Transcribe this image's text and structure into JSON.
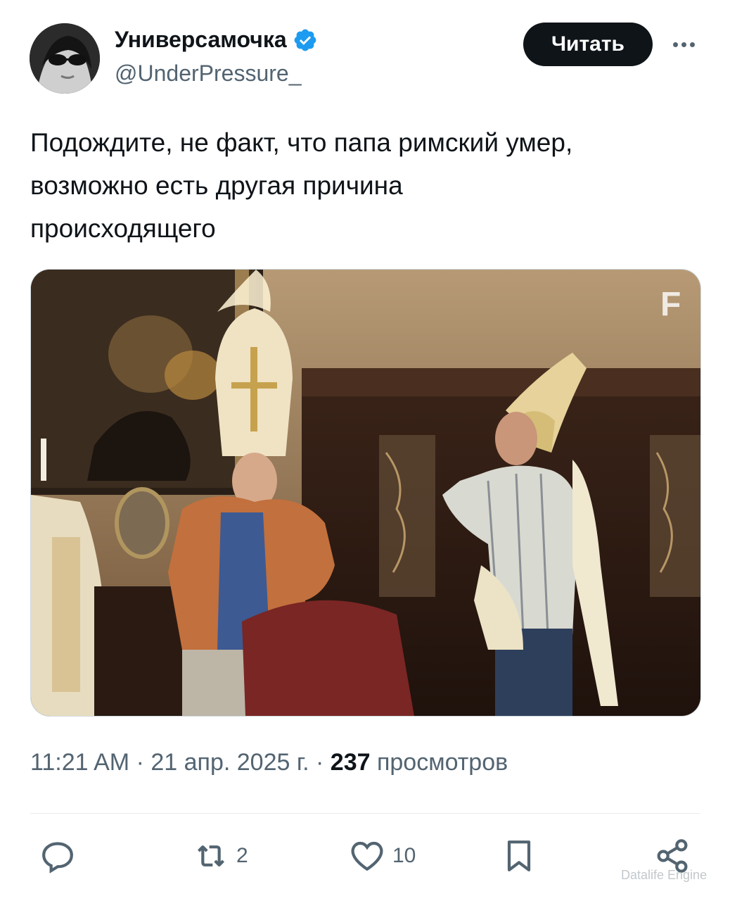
{
  "author": {
    "display_name": "Универсамочка",
    "handle": "@UnderPressure_",
    "verified": true,
    "avatar": "avatar-woman-sunglasses"
  },
  "header": {
    "follow_label": "Читать",
    "more_icon": "more-dots-icon"
  },
  "tweet": {
    "text_lines": [
      "Подождите, не факт, что папа римский умер,",
      "возможно есть другая причина",
      "происходящего"
    ]
  },
  "media": {
    "badge": "F",
    "description": "photo"
  },
  "meta": {
    "time": "11:21 AM",
    "separator": "·",
    "date": "21 апр. 2025 г.",
    "views_count": "237",
    "views_label": "просмотров"
  },
  "actions": {
    "reply_icon": "reply-icon",
    "retweet_count": "2",
    "like_count": "10",
    "bookmark_icon": "bookmark-icon",
    "share_icon": "share-icon"
  },
  "watermark": "Datalife Engine",
  "colors": {
    "text": "#0f1419",
    "secondary": "#536471",
    "verified": "#1d9bf0",
    "button": "#0f1419"
  }
}
